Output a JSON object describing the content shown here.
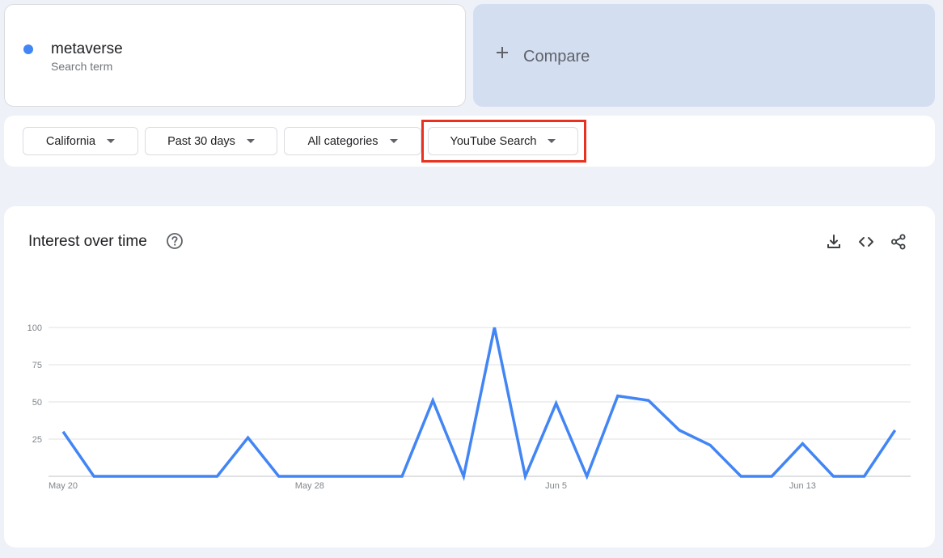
{
  "search_term": {
    "name": "metaverse",
    "subtitle": "Search term",
    "color": "#4285f4"
  },
  "compare": {
    "label": "Compare",
    "icon": "plus-icon"
  },
  "filters": {
    "location": "California",
    "time_range": "Past 30 days",
    "category": "All categories",
    "search_type": "YouTube Search"
  },
  "highlight_color": "#e8321f",
  "chart": {
    "title": "Interest over time",
    "icons": [
      "help-icon",
      "download-icon",
      "embed-icon",
      "share-icon"
    ]
  },
  "chart_data": {
    "type": "line",
    "title": "Interest over time",
    "xlabel": "",
    "ylabel": "",
    "ylim": [
      0,
      100
    ],
    "yticks": [
      25,
      50,
      75,
      100
    ],
    "x_tick_labels": [
      {
        "index": 0,
        "label": "May 20"
      },
      {
        "index": 8,
        "label": "May 28"
      },
      {
        "index": 16,
        "label": "Jun 5"
      },
      {
        "index": 24,
        "label": "Jun 13"
      }
    ],
    "grid": true,
    "series": [
      {
        "name": "metaverse",
        "color": "#4285f4",
        "x": [
          "May 20",
          "May 21",
          "May 22",
          "May 23",
          "May 24",
          "May 25",
          "May 26",
          "May 27",
          "May 28",
          "May 29",
          "May 30",
          "May 31",
          "Jun 1",
          "Jun 2",
          "Jun 3",
          "Jun 4",
          "Jun 5",
          "Jun 6",
          "Jun 7",
          "Jun 8",
          "Jun 9",
          "Jun 10",
          "Jun 11",
          "Jun 12",
          "Jun 13",
          "Jun 14",
          "Jun 15",
          "Jun 16"
        ],
        "values": [
          30,
          0,
          0,
          0,
          0,
          0,
          26,
          0,
          0,
          0,
          0,
          0,
          51,
          0,
          100,
          0,
          49,
          0,
          54,
          51,
          31,
          21,
          0,
          0,
          22,
          0,
          0,
          31
        ]
      }
    ]
  }
}
